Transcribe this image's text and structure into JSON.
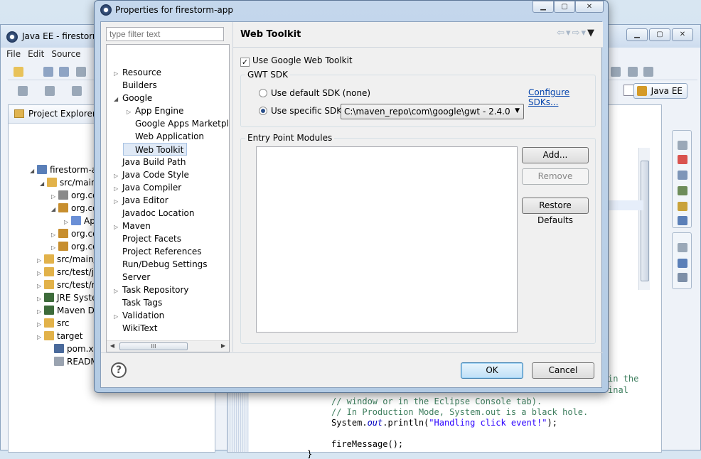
{
  "background_window": {
    "title": "Java EE - firestorm-",
    "menu": [
      "File",
      "Edit",
      "Source"
    ],
    "perspective_label": "Java EE",
    "explorer_tab": "Project Explorer",
    "tree": [
      {
        "label": "firestorm-app",
        "icon_color": "#5a7fb8"
      },
      {
        "label": "src/main/",
        "icon_color": "#e2b24a"
      },
      {
        "label": "org.co",
        "icon_color": "#8a8a8a"
      },
      {
        "label": "org.co",
        "icon_color": "#c78e2e"
      },
      {
        "label": "Ap",
        "icon_color": "#6a8fd6"
      },
      {
        "label": "org.co",
        "icon_color": "#c78e2e"
      },
      {
        "label": "org.co",
        "icon_color": "#c78e2e"
      },
      {
        "label": "src/main/",
        "icon_color": "#e2b24a"
      },
      {
        "label": "src/test/j",
        "icon_color": "#e2b24a"
      },
      {
        "label": "src/test/r",
        "icon_color": "#e2b24a"
      },
      {
        "label": "JRE Syster",
        "icon_color": "#3d6b3a"
      },
      {
        "label": "Maven De",
        "icon_color": "#3d6b3a"
      },
      {
        "label": "src",
        "icon_color": "#e2b24a"
      },
      {
        "label": "target",
        "icon_color": "#e2b24a"
      },
      {
        "label": "pom.xml",
        "icon_color": "#4a6a9b"
      },
      {
        "label": "README.",
        "icon_color": "#9aa3b0"
      }
    ],
    "code": {
      "line1": "in the",
      "line2": "inal",
      "line3": "// window or in the Eclipse Console tab).",
      "line4": "// In Production Mode, System.out is a black hole.",
      "line5_pre": "System.",
      "line5_out": "out",
      "line5_mid": ".println(",
      "line5_str": "\"Handling click event!\"",
      "line5_end": ");",
      "line6": "fireMessage();",
      "line7": "}"
    }
  },
  "dialog": {
    "title": "Properties for firestorm-app",
    "filter_placeholder": "type filter text",
    "nav_items": [
      {
        "label": "Resource",
        "expander": "▷",
        "indent": 0
      },
      {
        "label": "Builders",
        "expander": "",
        "indent": 0
      },
      {
        "label": "Google",
        "expander": "◢",
        "indent": 0
      },
      {
        "label": "App Engine",
        "expander": "▷",
        "indent": 1
      },
      {
        "label": "Google Apps Marketpla",
        "expander": "",
        "indent": 1
      },
      {
        "label": "Web Application",
        "expander": "",
        "indent": 1
      },
      {
        "label": "Web Toolkit",
        "expander": "",
        "indent": 1,
        "selected": true
      },
      {
        "label": "Java Build Path",
        "expander": "",
        "indent": 0
      },
      {
        "label": "Java Code Style",
        "expander": "▷",
        "indent": 0
      },
      {
        "label": "Java Compiler",
        "expander": "▷",
        "indent": 0
      },
      {
        "label": "Java Editor",
        "expander": "▷",
        "indent": 0
      },
      {
        "label": "Javadoc Location",
        "expander": "",
        "indent": 0
      },
      {
        "label": "Maven",
        "expander": "▷",
        "indent": 0
      },
      {
        "label": "Project Facets",
        "expander": "",
        "indent": 0
      },
      {
        "label": "Project References",
        "expander": "",
        "indent": 0
      },
      {
        "label": "Run/Debug Settings",
        "expander": "",
        "indent": 0
      },
      {
        "label": "Server",
        "expander": "",
        "indent": 0
      },
      {
        "label": "Task Repository",
        "expander": "▷",
        "indent": 0
      },
      {
        "label": "Task Tags",
        "expander": "",
        "indent": 0
      },
      {
        "label": "Validation",
        "expander": "▷",
        "indent": 0
      },
      {
        "label": "WikiText",
        "expander": "",
        "indent": 0
      }
    ],
    "scroll_thumb_grip": "III",
    "page_title": "Web Toolkit",
    "use_gwt_label": "Use Google Web Toolkit",
    "use_gwt_checked": true,
    "sdk_group_label": "GWT SDK",
    "default_sdk_label": "Use default SDK (none)",
    "configure_sdks_link": "Configure SDKs...",
    "specific_sdk_label": "Use specific SDK:",
    "specific_sdk_value": "C:\\maven_repo\\com\\google\\gwt - 2.4.0",
    "entry_group_label": "Entry Point Modules",
    "add_button": "Add...",
    "remove_button": "Remove",
    "restore_button": "Restore Defaults",
    "ok_button": "OK",
    "cancel_button": "Cancel",
    "help_glyph": "?"
  }
}
